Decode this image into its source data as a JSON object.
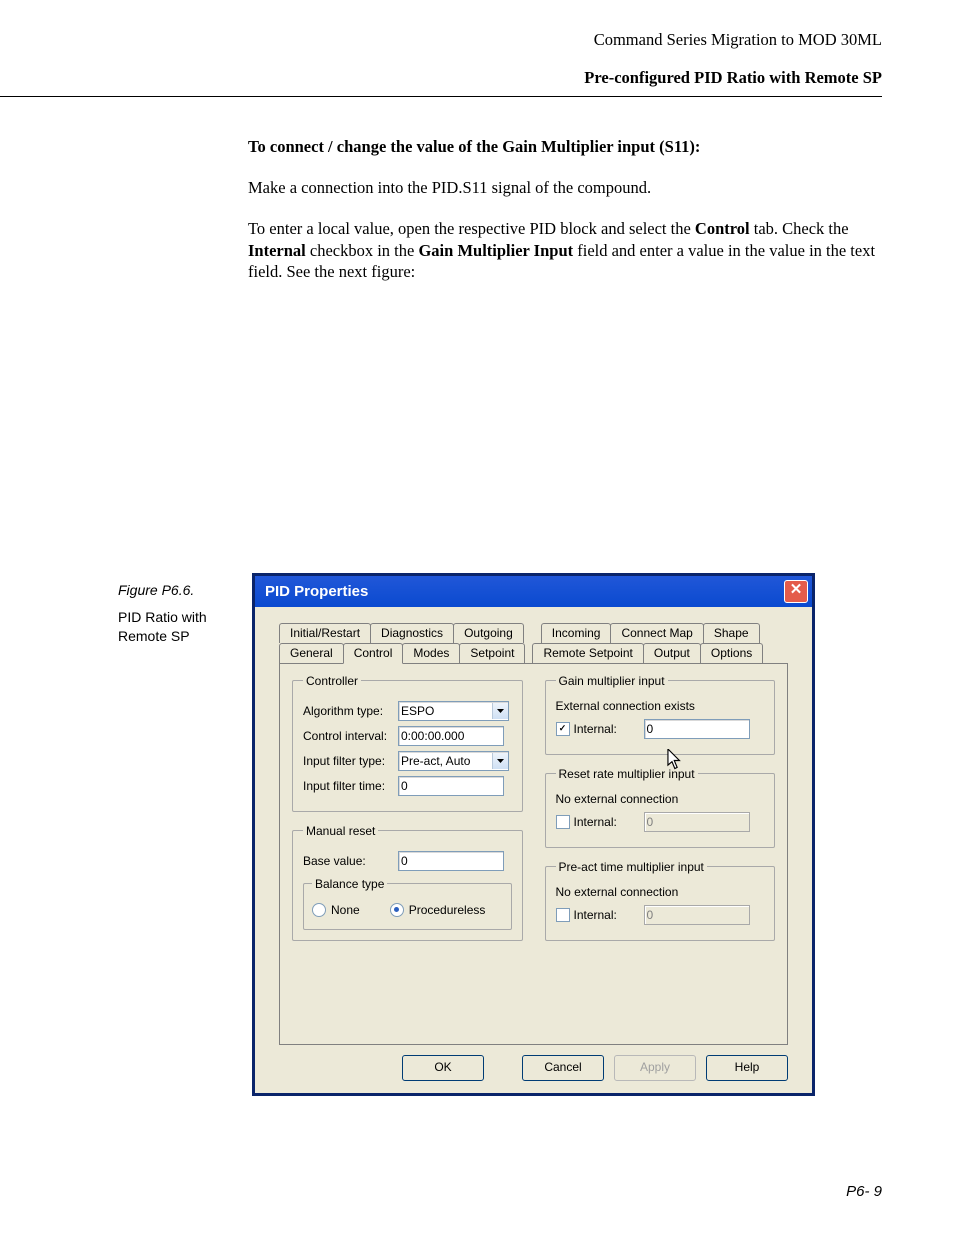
{
  "header": {
    "line1": "Command Series Migration to MOD 30ML",
    "line2": "Pre-configured PID Ratio with Remote SP"
  },
  "instructions": {
    "title": "To connect / change the value of the Gain Multiplier input (S11):",
    "p1": "Make a connection into the PID.S11 signal of the compound.",
    "p2a": "To enter a local value, open the respective PID block and select the ",
    "p2b": "Control",
    "p2c": " tab. Check the ",
    "p2d": "Internal",
    "p2e": " checkbox in the ",
    "p2f": "Gain Multiplier Input",
    "p2g": " field and enter a value in the  value in the text field. See the next figure:"
  },
  "caption": {
    "fig": "Figure P6.6.",
    "text": "PID Ratio with Remote SP"
  },
  "dialog": {
    "title": "PID Properties",
    "tabs_row1": [
      "Initial/Restart",
      "Diagnostics",
      "Outgoing",
      "Incoming",
      "Connect Map",
      "Shape"
    ],
    "tabs_row2": [
      "General",
      "Control",
      "Modes",
      "Setpoint",
      "Remote Setpoint",
      "Output",
      "Options"
    ],
    "active_tab": "Control",
    "controller": {
      "legend": "Controller",
      "algo_label": "Algorithm type:",
      "algo_value": "ESPO",
      "interval_label": "Control interval:",
      "interval_value": "0:00:00.000",
      "filter_type_label": "Input filter type:",
      "filter_type_value": "Pre-act, Auto",
      "filter_time_label": "Input filter time:",
      "filter_time_value": "0"
    },
    "manual_reset": {
      "legend": "Manual reset",
      "base_label": "Base value:",
      "base_value": "0",
      "balance_legend": "Balance type",
      "opt_none": "None",
      "opt_proc": "Procedureless"
    },
    "gain": {
      "legend": "Gain multiplier input",
      "status": "External connection exists",
      "internal_label": "Internal:",
      "internal_value": "0"
    },
    "reset": {
      "legend": "Reset rate multiplier input",
      "status": "No external connection",
      "internal_label": "Internal:",
      "internal_value": "0"
    },
    "preact": {
      "legend": "Pre-act time multiplier input",
      "status": "No external connection",
      "internal_label": "Internal:",
      "internal_value": "0"
    },
    "buttons": {
      "ok": "OK",
      "cancel": "Cancel",
      "apply": "Apply",
      "help": "Help"
    }
  },
  "footer": "P6- 9"
}
